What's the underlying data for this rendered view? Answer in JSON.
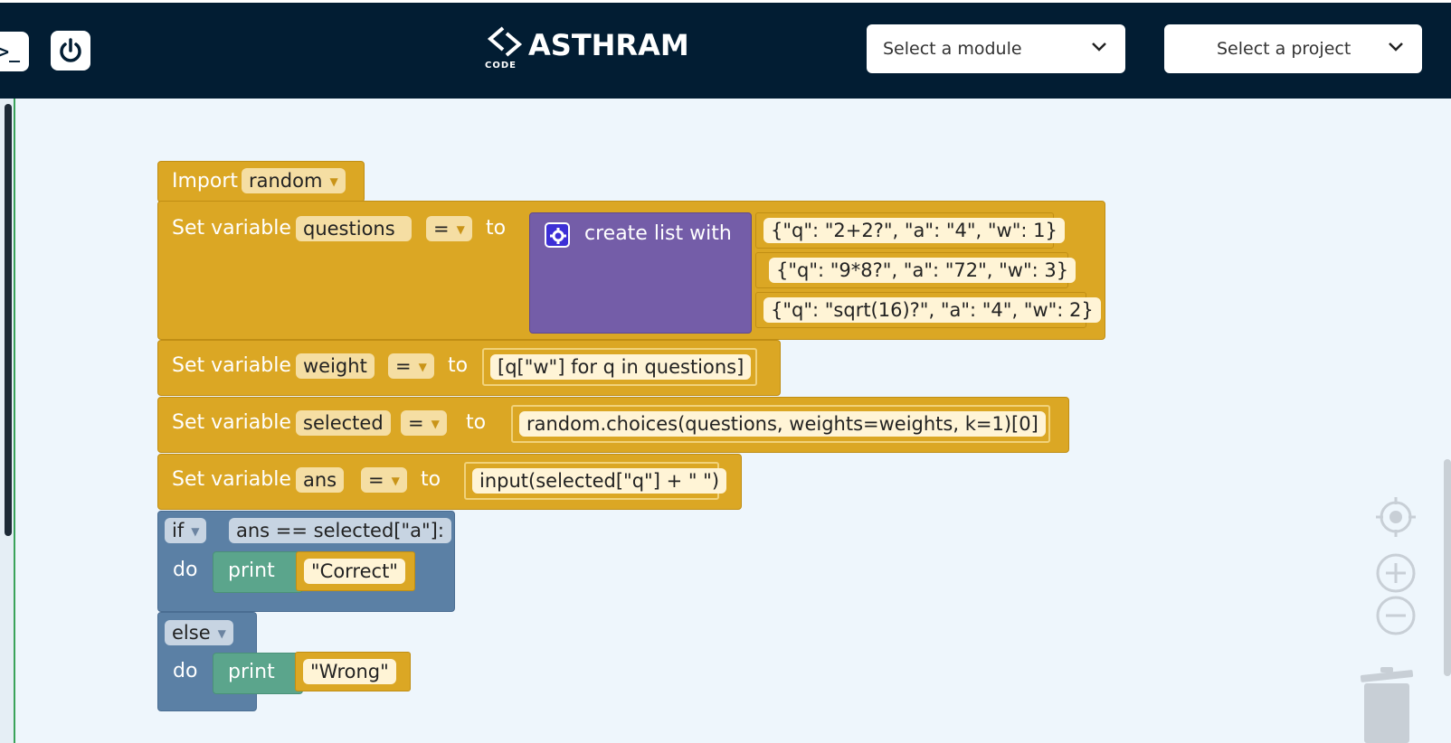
{
  "header": {
    "terminal_label": ">_",
    "logo_text": "ASTHRAM",
    "logo_subtext": "CODE",
    "module_select": "Select a module",
    "project_select": "Select a project"
  },
  "blocks": {
    "import": {
      "label": "Import",
      "module": "random"
    },
    "set_questions": {
      "label": "Set variable",
      "name": "questions",
      "op": "=",
      "to": "to",
      "list_label": "create list with",
      "items": [
        "{\"q\": \"2+2?\", \"a\": \"4\", \"w\": 1}",
        "{\"q\": \"9*8?\", \"a\": \"72\", \"w\": 3}",
        "{\"q\": \"sqrt(16)?\", \"a\": \"4\", \"w\": 2}"
      ]
    },
    "set_weight": {
      "label": "Set variable",
      "name": "weight",
      "op": "=",
      "to": "to",
      "value": "[q[\"w\"] for q in questions]"
    },
    "set_selected": {
      "label": "Set variable",
      "name": "selected",
      "op": "=",
      "to": "to",
      "value": "random.choices(questions, weights=weights, k=1)[0]"
    },
    "set_ans": {
      "label": "Set variable",
      "name": "ans",
      "op": "=",
      "to": "to",
      "value": "input(selected[\"q\"] + \" \")"
    },
    "if_block": {
      "keyword": "if",
      "condition": "ans == selected[\"a\"]:",
      "do": "do",
      "print": "print",
      "value": "\"Correct\""
    },
    "else_block": {
      "keyword": "else",
      "do": "do",
      "print": "print",
      "value": "\"Wrong\""
    }
  },
  "controls": [
    "recenter-icon",
    "zoom-in-icon",
    "zoom-out-icon",
    "trash-icon"
  ],
  "colors": {
    "header": "#021d33",
    "variables": "#dba724",
    "lists": "#745da8",
    "logic": "#5b80a5",
    "text": "#5ba58c",
    "workspace": "#eef6fc"
  }
}
